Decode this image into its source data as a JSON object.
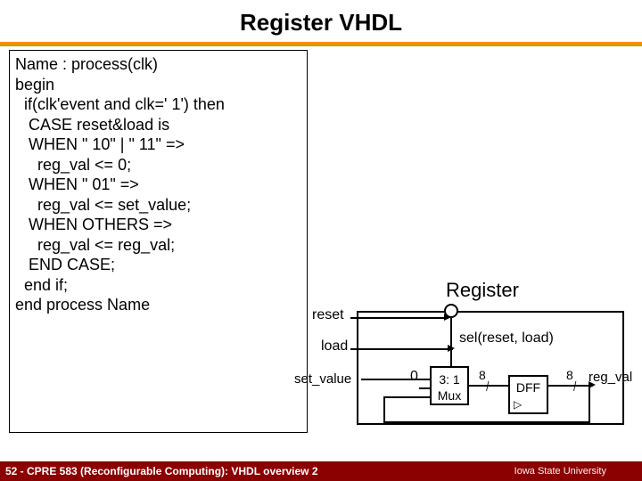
{
  "title": "Register VHDL",
  "code": "Name : process(clk)\nbegin\n  if(clk'event and clk=' 1') then\n   CASE reset&load is\n   WHEN \" 10\" | \" 11\" =>\n     reg_val <= 0;\n   WHEN \" 01\" =>\n     reg_val <= set_value;\n   WHEN OTHERS =>\n     reg_val <= reg_val;\n   END CASE;\n  end if;\nend process Name",
  "diag": {
    "title": "Register",
    "reset": "reset",
    "load": "load",
    "set_value": "set_value",
    "sel": "sel(reset, load)",
    "zero": "0",
    "mux_l1": "3: 1",
    "mux_l2": "Mux",
    "dff": "DFF",
    "bus8a": "8",
    "bus8b": "8",
    "out": "reg_val"
  },
  "footer_left": "52 - CPRE 583 (Reconfigurable Computing):  VHDL overview 2",
  "footer_right": "Iowa State University"
}
